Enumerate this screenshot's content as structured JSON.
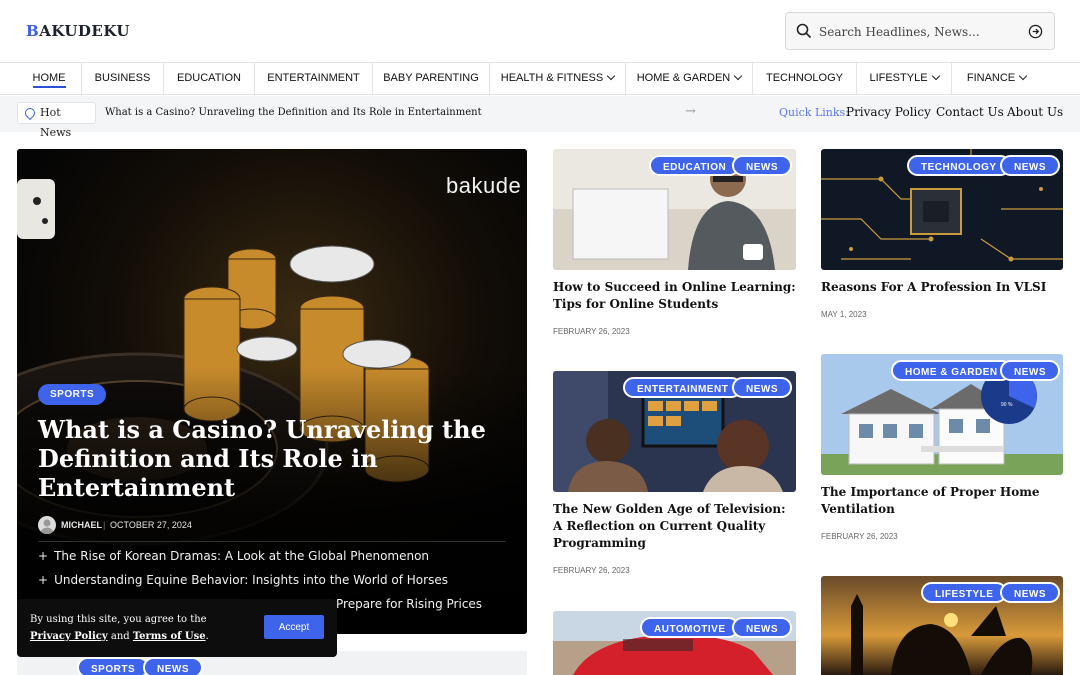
{
  "brand": {
    "logo_first": "B",
    "logo_rest": "AKUDEKU",
    "accent": "#3d64ea"
  },
  "search": {
    "placeholder": "Search Headlines, News..."
  },
  "nav": {
    "items": [
      {
        "label": "HOME",
        "active": true
      },
      {
        "label": "BUSINESS"
      },
      {
        "label": "EDUCATION"
      },
      {
        "label": "ENTERTAINMENT"
      },
      {
        "label": "BABY PARENTING"
      },
      {
        "label": "HEALTH & FITNESS",
        "dropdown": true
      },
      {
        "label": "HOME & GARDEN",
        "dropdown": true
      },
      {
        "label": "TECHNOLOGY"
      },
      {
        "label": "LIFESTYLE",
        "dropdown": true
      },
      {
        "label": "FINANCE",
        "dropdown": true
      }
    ]
  },
  "ticker": {
    "hot_label": "Hot News",
    "headline": "What is a Casino? Unraveling the Definition and Its Role in Entertainment",
    "quick_label": "Quick Links:",
    "links": [
      "Privacy Policy",
      "Contact Us",
      "About Us"
    ]
  },
  "hero": {
    "brandmark": "bakude",
    "category": "SPORTS",
    "title": "What is a Casino? Unraveling the Definition and Its Role in Entertainment",
    "author": "MICHAEL",
    "date": "OCTOBER 27, 2024",
    "related": [
      "The Rise of Korean Dramas: A Look at the Global Phenomenon",
      "Understanding Equine Behavior: Insights into the World of Horses",
      "Prepare for Rising Prices"
    ]
  },
  "cards": [
    {
      "category": "EDUCATION",
      "tag": "NEWS",
      "title": "How to Succeed in Online Learning: Tips for Online Students",
      "date": "FEBRUARY 26, 2023"
    },
    {
      "category": "TECHNOLOGY",
      "tag": "NEWS",
      "title": "Reasons For A Profession In VLSI",
      "date": "MAY 1, 2023"
    },
    {
      "category": "ENTERTAINMENT",
      "tag": "NEWS",
      "title": "The New Golden Age of Television: A Reflection on Current Quality Programming",
      "date": "FEBRUARY 26, 2023"
    },
    {
      "category": "HOME & GARDEN",
      "tag": "NEWS",
      "title": "The Importance of Proper Home Ventilation",
      "date": "FEBRUARY 26, 2023",
      "image_text": "90 %"
    },
    {
      "category": "AUTOMOTIVE",
      "tag": "NEWS"
    },
    {
      "category": "LIFESTYLE",
      "tag": "NEWS"
    }
  ],
  "bottom_left": {
    "category": "SPORTS",
    "tag": "NEWS"
  },
  "cookie": {
    "text_before": "By using this site, you agree to the ",
    "privacy": "Privacy Policy",
    "and": " and ",
    "terms": "Terms of Use",
    "period": ".",
    "accept": "Accept"
  }
}
